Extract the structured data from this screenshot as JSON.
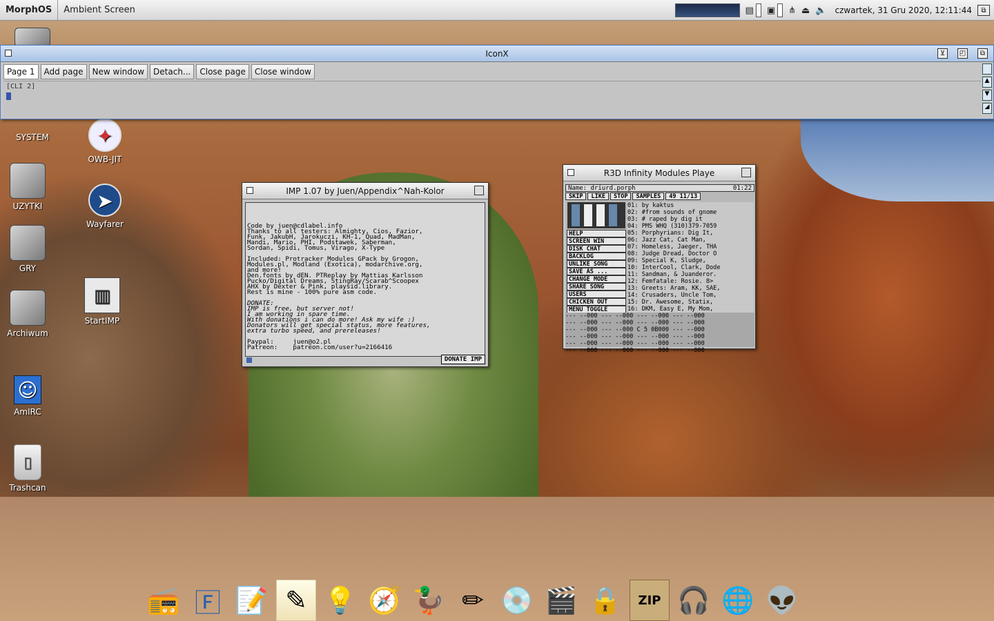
{
  "topbar": {
    "brand": "MorphOS",
    "screen_title": "Ambient Screen",
    "clock": "czwartek, 31 Gru 2020, 12:11:44",
    "icons": [
      "cpu-meter-icon",
      "memory-icon",
      "network-icon",
      "eject-icon",
      "speaker-icon",
      "screen-depth-icon"
    ]
  },
  "iconx": {
    "title": "IconX",
    "tabs": [
      "Page 1",
      "Add page",
      "New window",
      "Detach...",
      "Close page",
      "Close window"
    ],
    "cli_label": "[CLI 2]"
  },
  "desktop_icons": [
    {
      "label": "SYSTEM",
      "icon": "hard-disk-icon"
    },
    {
      "label": "OWB-JIT",
      "icon": "browser-icon"
    },
    {
      "label": "UZYTKI",
      "icon": "hard-disk-icon"
    },
    {
      "label": "Wayfarer",
      "icon": "compass-browser-icon"
    },
    {
      "label": "GRY",
      "icon": "hard-disk-icon"
    },
    {
      "label": "Archiwum",
      "icon": "hard-disk-icon"
    },
    {
      "label": "StartIMP",
      "icon": "radio-player-icon"
    },
    {
      "label": "AmIRC",
      "icon": "chat-icon"
    },
    {
      "label": "Trashcan",
      "icon": "trash-icon"
    }
  ],
  "imp": {
    "title": "IMP 1.07 by Juen/Appendix^Nah-Kolor",
    "lines": [
      "Code by juen@cdlabel.info",
      "Thanks to all testers: Almighty, Cios, Fazior,",
      "Funk, JakubH, Jarokuczi, KH-1, Quad, MadMan,",
      "Mandi, Mario, PHI, Podstawek, Saberman,",
      "Sordan, Spidi, Tomus, Virago, X-Type",
      "",
      "Included: Protracker Modules GPack by Grogon,",
      "Modules.pl, Modland (Exotica), modarchive.org,",
      "and more!",
      "Den.fonts by dEN. PTReplay by Mattias Karlsson",
      "Pucko/Digital Dreams, StingRay/Scarab^Scoopex",
      "AHX by Dexter & Pink, playsid.library.",
      "Rest is mine - 100% pure asm code.",
      "",
      "DONATE:",
      "IMP is free, but server not!",
      "I am working in spare time.",
      "With donations i can do more! Ask my wife :)",
      "Donators will get special status, more features,",
      "extra turbo speed, and prereleases!",
      "",
      "Paypal:     juen@o2.pl",
      "Patreon:    patreon.com/user?u=2166416"
    ],
    "donate_button": "DONATE IMP"
  },
  "r3d": {
    "title": "R3D Infinity Modules Playe",
    "name": "Name: driurd.porph",
    "time": "01:22",
    "controls": [
      "SKIP",
      "LIKE",
      "STOP",
      "SAMPLES",
      "49 11/13"
    ],
    "side_buttons": [
      "HELP",
      "SCREEN  WIN",
      "DISK   CHAT",
      "BACKLOG",
      "UNLIKE SONG",
      "SAVE AS ...",
      "CHANGE MODE",
      "SHARE SONG",
      "USERS",
      "CHICKEN OUT",
      "MENU TOGGLE"
    ],
    "playlist": [
      "01: by kaktus",
      "02: #from sounds of gnome",
      "03: # raped by dig it",
      "04: PMS WHQ (310)379-7059",
      "05: Porphyrians: Dig It,",
      "06: Jazz Cat, Cat Man,",
      "07: Homeless, Jaeger, THA",
      "08: Judge Dread, Doctor O",
      "09: Special K, Sludge,",
      "10: InterCool, Clark, Dode",
      "11: Sandman, & Juanderor.",
      "12: Femfatale: Rosie. 8>",
      "13: Greets: Aram, KK, SAE,",
      "14: Crusaders, Uncle Tom,",
      "15: Dr. Awesome, Statix,",
      "16: DKM, Easy E, My Mom,"
    ],
    "pattern": [
      "--- --000 --- --000 --- --000 --- --000",
      "--- --000 --- --000 --- --000 --- --000",
      "--- --000 --- --000 C 5 0B000 --- --000",
      "--- --000 --- --000 --- --000 --- --000",
      "--- --000 --- --000 --- --000 --- --000",
      "--- --000 --- --000 --- --000 --- --000"
    ]
  },
  "dock": [
    "radio-icon",
    "text-editor-icon",
    "notepad-icon",
    "pen-paper-icon",
    "light-bulb-icon",
    "compass-browser-icon",
    "rubber-duck-icon",
    "pencil-figure-icon",
    "cd-drive-icon",
    "movie-clapper-icon",
    "lock-disk-icon",
    "zip-box-icon",
    "headphones-icon",
    "globe-network-icon",
    "alien-icon"
  ]
}
